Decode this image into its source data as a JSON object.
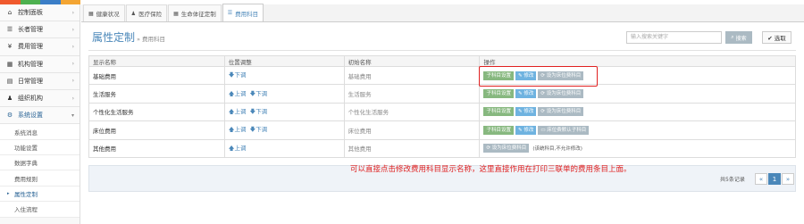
{
  "colors": {
    "strip": [
      "#f0592d",
      "#4db14f",
      "#3b7ec7",
      "#f3a533"
    ],
    "accent": "#4a87b9",
    "annotation": "#e02020"
  },
  "sidebar": {
    "items": [
      {
        "label": "控制面板",
        "icon": "dashboard-icon",
        "glyph": "⌂"
      },
      {
        "label": "长者管理",
        "icon": "list-icon",
        "glyph": "☰"
      },
      {
        "label": "费用管理",
        "icon": "yen-icon",
        "glyph": "¥"
      },
      {
        "label": "机构管理",
        "icon": "building-icon",
        "glyph": "▦"
      },
      {
        "label": "日常管理",
        "icon": "calendar-icon",
        "glyph": "▤"
      },
      {
        "label": "组织机构",
        "icon": "org-icon",
        "glyph": "♟"
      },
      {
        "label": "系统设置",
        "icon": "gear-icon",
        "glyph": "⚙"
      }
    ],
    "subitems": [
      "系统消息",
      "功能设置",
      "数据字典",
      "费用规则",
      "属性定制",
      "入住流程"
    ]
  },
  "tabs": [
    {
      "label": "健康状况",
      "glyph": "▦"
    },
    {
      "label": "医疗保险",
      "glyph": "♟"
    },
    {
      "label": "生命体征定制",
      "glyph": "▦"
    },
    {
      "label": "费用科目",
      "glyph": "☰"
    }
  ],
  "header": {
    "title": "属性定制",
    "subtitle": "» 费用科目"
  },
  "search": {
    "placeholder": "输入搜索关键字",
    "button": "搜索",
    "select": "✔ 选取"
  },
  "table": {
    "headers": [
      "显示名称",
      "位置调整",
      "初始名称",
      "操作"
    ],
    "rows": [
      {
        "name": "基础费用",
        "init": "基础费用",
        "up": "",
        "down": "下调",
        "btns": [
          "子科目设置",
          "修改",
          "设为床位费科目"
        ]
      },
      {
        "name": "生活服务",
        "init": "生活服务",
        "up": "上调",
        "down": "下调",
        "btns": [
          "子科目设置",
          "修改",
          "设为床位费科目"
        ]
      },
      {
        "name": "个性化生活服务",
        "init": "个性化生活服务",
        "up": "上调",
        "down": "下调",
        "btns": [
          "子科目设置",
          "修改",
          "设为床位费科目"
        ]
      },
      {
        "name": "床位费用",
        "init": "床位费用",
        "up": "上调",
        "down": "下调",
        "btns": [
          "子科目设置",
          "修改",
          "床位费默认子科目"
        ]
      },
      {
        "name": "其他费用",
        "init": "其他费用",
        "up": "上调",
        "down": "",
        "btns": [
          "设为床位费科目"
        ],
        "note": "(该统科目,不允许修改)"
      }
    ]
  },
  "annotation": "可以直接点击修改费用科目显示名称，这里直接作用在打印三联单的费用条目上面。",
  "pagination": {
    "total": "共5条记录",
    "prev": "«",
    "page": "1",
    "next": "»"
  }
}
